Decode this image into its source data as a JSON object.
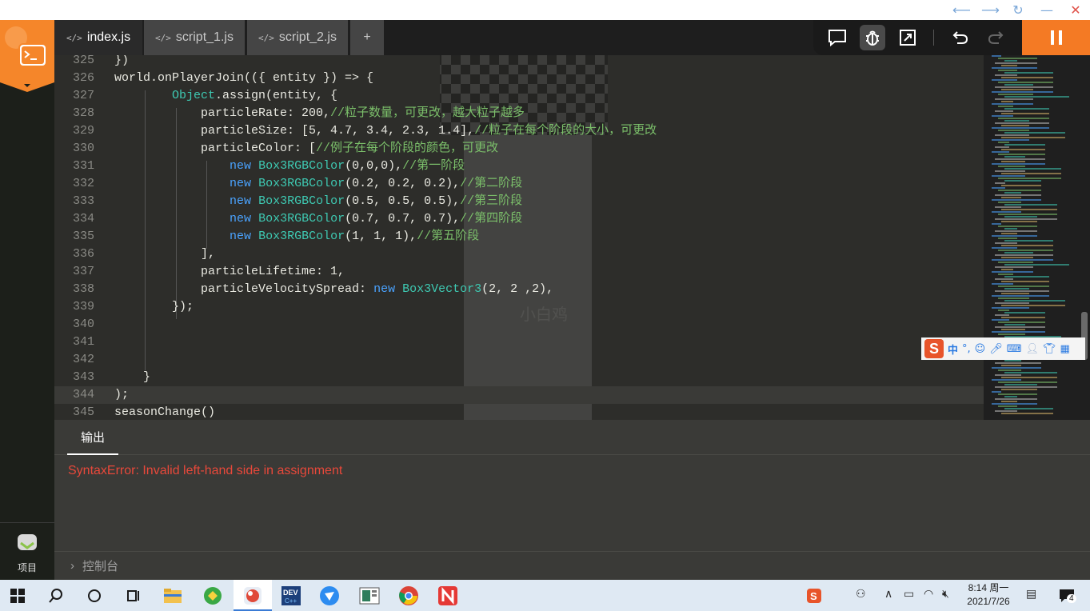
{
  "window": {
    "controls": [
      "back",
      "forward",
      "refresh",
      "minimize",
      "close"
    ]
  },
  "sidebar": {
    "project_label": "项目"
  },
  "tabs": [
    {
      "label": "index.js",
      "active": true
    },
    {
      "label": "script_1.js",
      "active": false
    },
    {
      "label": "script_2.js",
      "active": false
    },
    {
      "label": "+",
      "active": false
    }
  ],
  "toolbar": {
    "icons": [
      "comment-icon",
      "debug-bug-icon",
      "expand-icon",
      "undo-icon",
      "redo-icon"
    ],
    "run_button_icon": "pause-icon"
  },
  "editor": {
    "current_line": "344",
    "lines": [
      {
        "num": "325",
        "code": "})"
      },
      {
        "num": "326",
        "code": "world.onPlayerJoin(({ entity }) => {"
      },
      {
        "num": "327",
        "code": "        Object.assign(entity, {"
      },
      {
        "num": "328",
        "code": "            particleRate: 200,//粒子数量，可更改，越大粒子越多"
      },
      {
        "num": "329",
        "code": "            particleSize: [5, 4.7, 3.4, 2.3, 1.4],//粒子在每个阶段的大小，可更改"
      },
      {
        "num": "330",
        "code": "            particleColor: [//例子在每个阶段的颜色，可更改"
      },
      {
        "num": "331",
        "code": "                new Box3RGBColor(0,0,0),//第一阶段"
      },
      {
        "num": "332",
        "code": "                new Box3RGBColor(0.2, 0.2, 0.2),//第二阶段"
      },
      {
        "num": "333",
        "code": "                new Box3RGBColor(0.5, 0.5, 0.5),//第三阶段"
      },
      {
        "num": "334",
        "code": "                new Box3RGBColor(0.7, 0.7, 0.7),//第四阶段"
      },
      {
        "num": "335",
        "code": "                new Box3RGBColor(1, 1, 1),//第五阶段"
      },
      {
        "num": "336",
        "code": "            ],"
      },
      {
        "num": "337",
        "code": "            particleLifetime: 1,"
      },
      {
        "num": "338",
        "code": "            particleVelocitySpread: new Box3Vector3(2, 2 ,2),"
      },
      {
        "num": "339",
        "code": "        });"
      },
      {
        "num": "340",
        "code": ""
      },
      {
        "num": "341",
        "code": ""
      },
      {
        "num": "342",
        "code": ""
      },
      {
        "num": "343",
        "code": "    }"
      },
      {
        "num": "344",
        "code": ");"
      },
      {
        "num": "345",
        "code": "seasonChange()"
      }
    ]
  },
  "background_overlay": {
    "name_tag": "小白鸡"
  },
  "output": {
    "tab_label": "输出",
    "error": "SyntaxError: Invalid left-hand side in assignment",
    "console_label": "控制台"
  },
  "ime": {
    "mode": "中",
    "punct": "°,"
  },
  "taskbar": {
    "clock_time": "8:14 周一",
    "clock_date": "2021/7/26",
    "notification_count": "4"
  },
  "colors": {
    "accent": "#f47a24",
    "error": "#e8483a",
    "keyword": "#4aa3ff",
    "type": "#3ec9b2",
    "comment": "#7bbf6a"
  }
}
